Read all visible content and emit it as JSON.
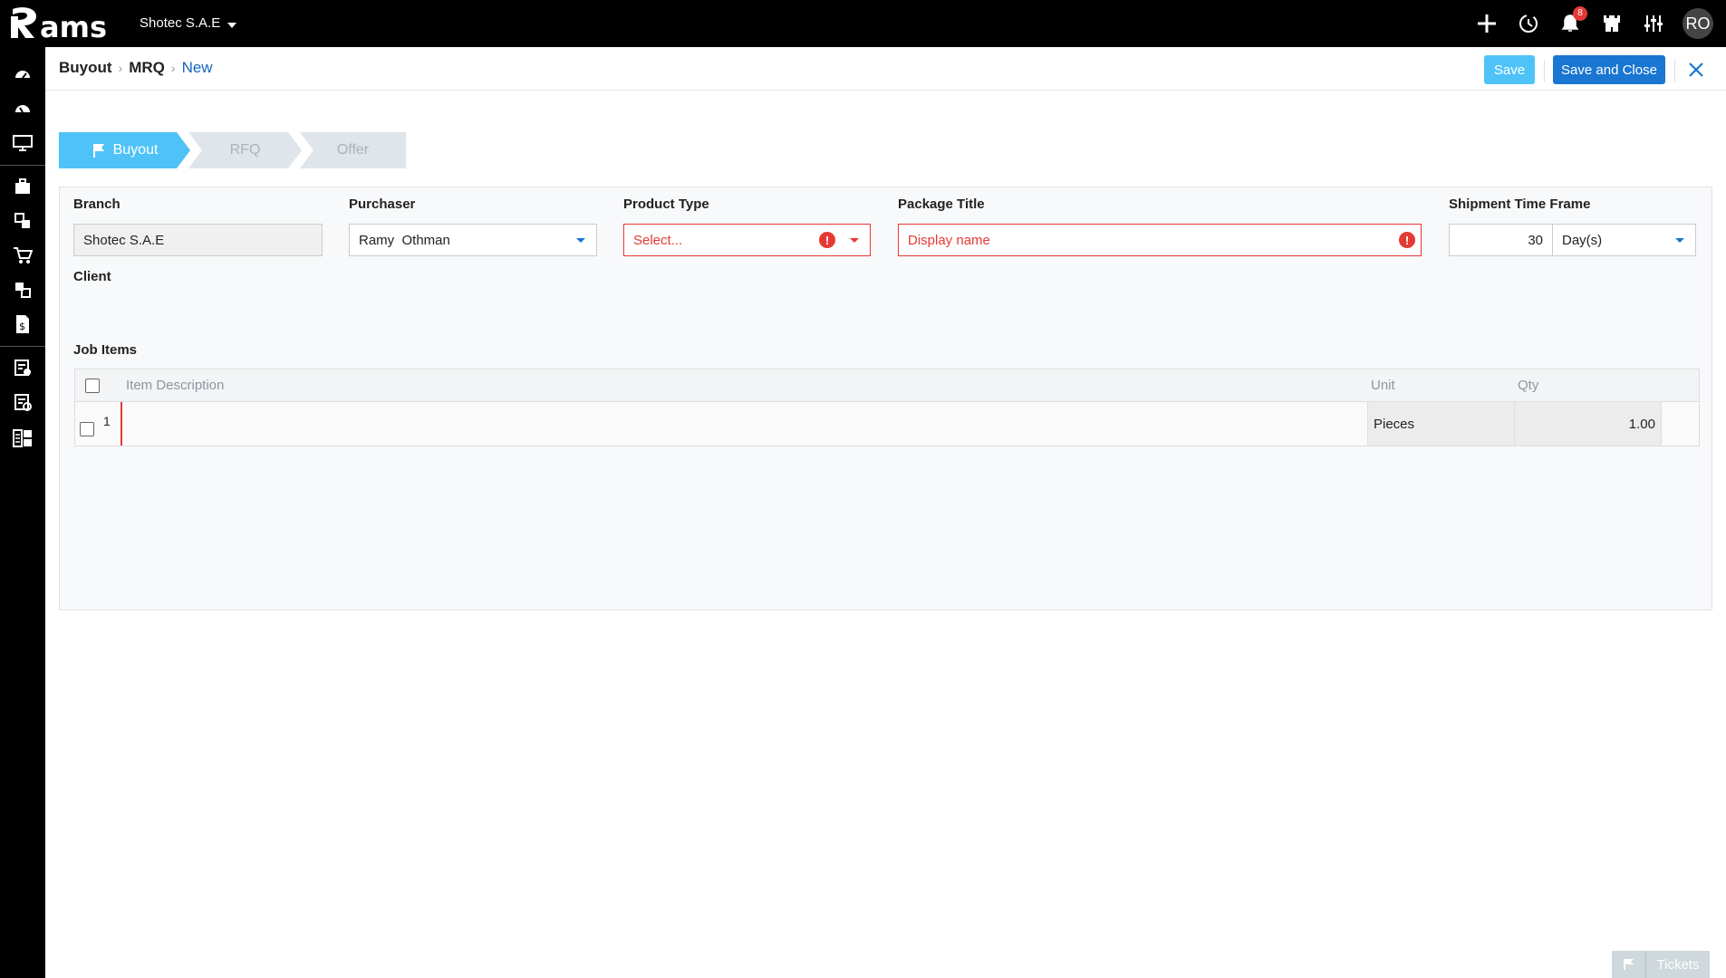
{
  "app": {
    "logo_text": "ams",
    "company": "Shotec S.A.E",
    "notifications_count": "8",
    "user_initials": "RO"
  },
  "top_icons": [
    "plus-icon",
    "history-icon",
    "bell-icon",
    "castle-icon",
    "sliders-icon"
  ],
  "sidebar_icons": [
    "dashboard-icon",
    "dashboard-alt-icon",
    "monitor-icon",
    "briefcase-icon",
    "transfer-icon",
    "cart-icon",
    "transfer-alt-icon",
    "invoice-dollar-icon",
    "checklist-icon",
    "settings-doc-icon",
    "modules-icon"
  ],
  "breadcrumb": {
    "item1": "Buyout",
    "item2": "MRQ",
    "item3": "New"
  },
  "actions": {
    "save": "Save",
    "save_close": "Save and Close"
  },
  "steps": {
    "step1": "Buyout",
    "step2": "RFQ",
    "step3": "Offer",
    "active": "Buyout"
  },
  "form": {
    "branch_label": "Branch",
    "branch_value": "Shotec S.A.E",
    "purchaser_label": "Purchaser",
    "purchaser_value": "Ramy  Othman",
    "product_type_label": "Product Type",
    "product_type_placeholder": "Select...",
    "package_title_label": "Package Title",
    "package_title_placeholder": "Display name",
    "shipment_label": "Shipment Time Frame",
    "shipment_value": "30",
    "shipment_unit": "Day(s)",
    "client_label": "Client",
    "job_items_label": "Job Items"
  },
  "grid": {
    "col_description": "Item Description",
    "col_unit": "Unit",
    "col_qty": "Qty",
    "rows": [
      {
        "num": "1",
        "description": "",
        "unit": "Pieces",
        "qty": "1.00"
      }
    ]
  },
  "tickets_label": "Tickets",
  "colors": {
    "primary": "#1976d2",
    "save": "#4fc3f7",
    "error": "#e53935",
    "step_active": "#4fc3f7",
    "step_inactive": "#dfe5ea"
  }
}
